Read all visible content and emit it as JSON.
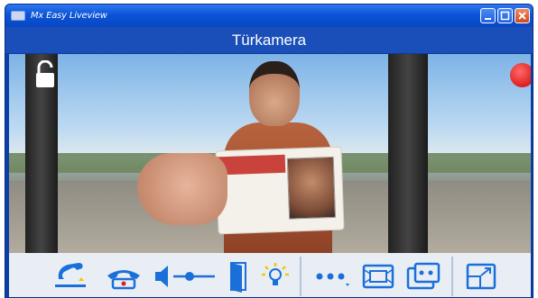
{
  "window": {
    "title": "Mx Easy Liveview"
  },
  "header": {
    "camera_name": "Türkamera"
  },
  "colors": {
    "accent": "#1a4fba",
    "icon_blue": "#1b6fd9",
    "record_red": "#e01e1e",
    "bell_yellow": "#f4c800"
  },
  "toolbar": {
    "items": [
      {
        "name": "accept-call",
        "icon": "phone-pickup-icon"
      },
      {
        "name": "hang-up",
        "icon": "phone-hangup-icon"
      },
      {
        "name": "volume",
        "icon": "speaker-slider-icon"
      },
      {
        "name": "door-open",
        "icon": "door-icon"
      },
      {
        "name": "light",
        "icon": "light-bulb-icon"
      },
      {
        "name": "more",
        "icon": "more-dots-icon"
      },
      {
        "name": "view-fit",
        "icon": "fit-screen-icon"
      },
      {
        "name": "view-double",
        "icon": "double-view-icon"
      },
      {
        "name": "fullscreen",
        "icon": "fullscreen-icon"
      }
    ]
  }
}
